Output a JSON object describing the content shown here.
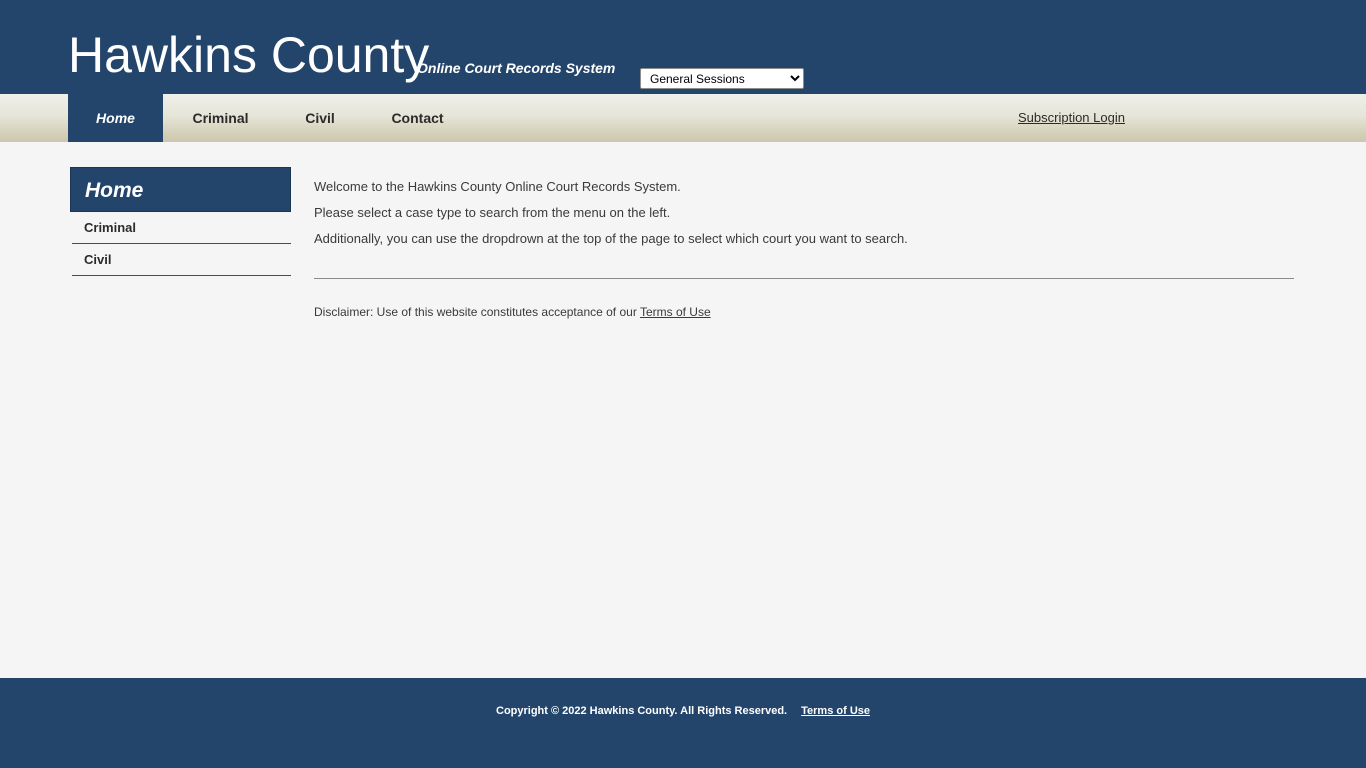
{
  "header": {
    "title": "Hawkins County",
    "subtitle": "Online Court Records System",
    "court_select": {
      "selected": "General Sessions",
      "options": [
        "General Sessions"
      ],
      "icon": "chevron-down-icon"
    }
  },
  "nav": {
    "items": [
      {
        "label": "Home",
        "active": true
      },
      {
        "label": "Criminal",
        "active": false
      },
      {
        "label": "Civil",
        "active": false
      },
      {
        "label": "Contact",
        "active": false
      }
    ],
    "subscription_login": "Subscription Login"
  },
  "sidebar": {
    "header": "Home",
    "items": [
      {
        "label": "Criminal"
      },
      {
        "label": "Civil"
      }
    ]
  },
  "main": {
    "lines": [
      "Welcome to the Hawkins County Online Court Records System.",
      "Please select a case type to search from the menu on the left.",
      "Additionally, you can use the dropdrown at the top of the page to select which court you want to search."
    ],
    "disclaimer_text": "Disclaimer: Use of this website constitutes acceptance of our ",
    "disclaimer_link": "Terms of Use"
  },
  "footer": {
    "copyright": "Copyright © 2022 Hawkins County. All Rights Reserved.",
    "terms_link": "Terms of Use"
  },
  "colors": {
    "brand_blue": "#23456b",
    "nav_gradient_top": "#eff0ea",
    "nav_gradient_bottom": "#ccc8ae",
    "page_background": "#f5f5f5",
    "text": "#3a3a3a"
  }
}
